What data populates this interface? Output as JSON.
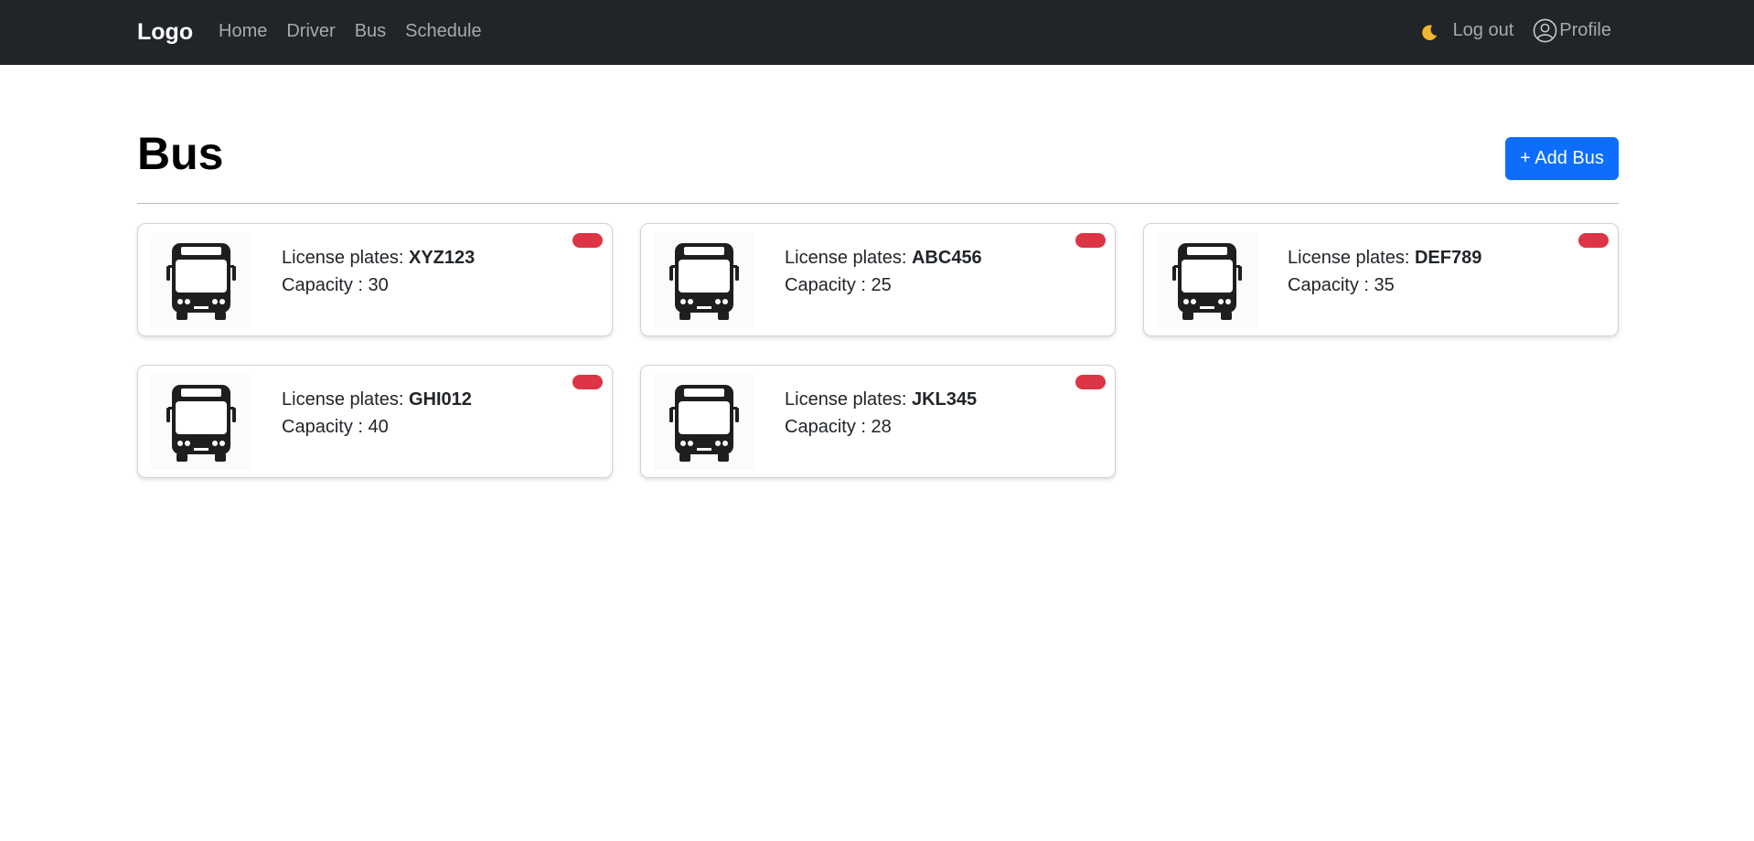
{
  "navbar": {
    "brand": "Logo",
    "links": [
      "Home",
      "Driver",
      "Bus",
      "Schedule"
    ],
    "logout_label": "Log out",
    "profile_label": "Profile",
    "theme_icon": "moon-icon",
    "profile_icon": "person-circle-icon"
  },
  "page": {
    "title": "Bus",
    "add_button_label": "+ Add Bus"
  },
  "card_labels": {
    "plate_prefix": "License plates: ",
    "capacity_prefix": "Capacity : "
  },
  "buses": [
    {
      "plate": "XYZ123",
      "capacity": "30"
    },
    {
      "plate": "ABC456",
      "capacity": "25"
    },
    {
      "plate": "DEF789",
      "capacity": "35"
    },
    {
      "plate": "GHI012",
      "capacity": "40"
    },
    {
      "plate": "JKL345",
      "capacity": "28"
    }
  ],
  "colors": {
    "navbar_bg": "#212529",
    "primary": "#0d6efd",
    "danger": "#dc3545"
  }
}
